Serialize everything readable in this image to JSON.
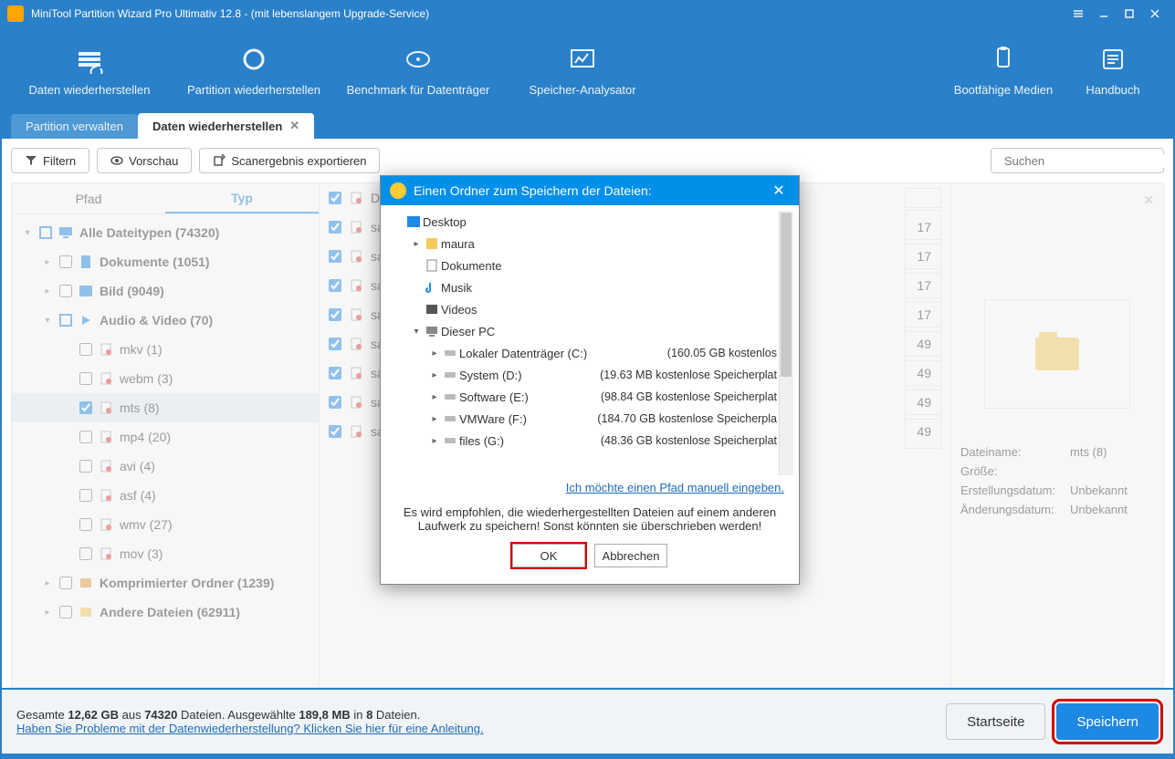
{
  "window": {
    "title": "MiniTool Partition Wizard Pro Ultimativ 12.8 - (mit lebenslangem Upgrade-Service)"
  },
  "ribbon": {
    "items": [
      {
        "label": "Daten wiederherstellen",
        "icon": "recover-data-icon"
      },
      {
        "label": "Partition wiederherstellen",
        "icon": "recover-partition-icon"
      },
      {
        "label": "Benchmark für Datenträger",
        "icon": "benchmark-icon"
      },
      {
        "label": "Speicher-Analysator",
        "icon": "analyzer-icon"
      }
    ],
    "right": [
      {
        "label": "Bootfähige Medien",
        "icon": "bootmedia-icon"
      },
      {
        "label": "Handbuch",
        "icon": "manual-icon"
      }
    ]
  },
  "tabs": {
    "inactive_label": "Partition verwalten",
    "active_label": "Daten wiederherstellen"
  },
  "toolbar": {
    "filter": "Filtern",
    "preview": "Vorschau",
    "export": "Scanergebnis exportieren",
    "search_placeholder": "Suchen"
  },
  "left_tabs": {
    "path": "Pfad",
    "type": "Typ"
  },
  "tree": [
    {
      "indent": 0,
      "chev": "▾",
      "chk": "blue",
      "icon": "monitor",
      "label": "Alle Dateitypen (74320)",
      "bold": true
    },
    {
      "indent": 1,
      "chev": "▸",
      "chk": "none",
      "icon": "doc",
      "label": "Dokumente (1051)",
      "bold": true
    },
    {
      "indent": 1,
      "chev": "▸",
      "chk": "none",
      "icon": "img",
      "label": "Bild (9049)",
      "bold": true
    },
    {
      "indent": 1,
      "chev": "▾",
      "chk": "blue",
      "icon": "av",
      "label": "Audio & Video (70)",
      "bold": true
    },
    {
      "indent": 2,
      "chev": "",
      "chk": "none",
      "icon": "file",
      "label": "mkv (1)"
    },
    {
      "indent": 2,
      "chev": "",
      "chk": "none",
      "icon": "file",
      "label": "webm (3)"
    },
    {
      "indent": 2,
      "chev": "",
      "chk": "checkblue",
      "icon": "file",
      "label": "mts (8)",
      "sel": true
    },
    {
      "indent": 2,
      "chev": "",
      "chk": "none",
      "icon": "file",
      "label": "mp4 (20)"
    },
    {
      "indent": 2,
      "chev": "",
      "chk": "none",
      "icon": "file",
      "label": "avi (4)"
    },
    {
      "indent": 2,
      "chev": "",
      "chk": "none",
      "icon": "file",
      "label": "asf (4)"
    },
    {
      "indent": 2,
      "chev": "",
      "chk": "none",
      "icon": "file",
      "label": "wmv (27)"
    },
    {
      "indent": 2,
      "chev": "",
      "chk": "none",
      "icon": "file",
      "label": "mov (3)"
    },
    {
      "indent": 1,
      "chev": "▸",
      "chk": "none",
      "icon": "zip",
      "label": "Komprimierter Ordner (1239)",
      "bold": true
    },
    {
      "indent": 1,
      "chev": "▸",
      "chk": "none",
      "icon": "other",
      "label": "Andere Dateien (62911)",
      "bold": true
    }
  ],
  "files": [
    {
      "name": "Date",
      "right": ""
    },
    {
      "name": "sam",
      "right": "17"
    },
    {
      "name": "sam",
      "right": "17"
    },
    {
      "name": "sam",
      "right": "17"
    },
    {
      "name": "sam",
      "right": "17"
    },
    {
      "name": "sam",
      "right": "49"
    },
    {
      "name": "sam",
      "right": "49"
    },
    {
      "name": "sam",
      "right": "49"
    },
    {
      "name": "sam",
      "right": "49"
    }
  ],
  "preview": {
    "filename_k": "Dateiname:",
    "filename_v": "mts (8)",
    "size_k": "Größe:",
    "size_v": "",
    "created_k": "Erstellungsdatum:",
    "created_v": "Unbekannt",
    "modified_k": "Änderungsdatum:",
    "modified_v": "Unbekannt"
  },
  "footer": {
    "line1_a": "Gesamte ",
    "line1_b": "12,62 GB",
    "line1_c": " aus ",
    "line1_d": "74320",
    "line1_e": " Dateien.   Ausgewählte ",
    "line1_f": "189,8 MB",
    "line1_g": " in ",
    "line1_h": "8",
    "line1_i": " Dateien.",
    "help_link": "Haben Sie Probleme mit der Datenwiederherstellung? Klicken Sie hier für eine Anleitung.",
    "home_btn": "Startseite",
    "save_btn": "Speichern"
  },
  "modal": {
    "title": "Einen Ordner zum Speichern der Dateien:",
    "rows": [
      {
        "indent": 0,
        "chev": "",
        "icon": "desktop",
        "name": "Desktop",
        "size": "",
        "sel": true
      },
      {
        "indent": 1,
        "chev": "▸",
        "icon": "user",
        "name": "maura",
        "size": ""
      },
      {
        "indent": 1,
        "chev": "",
        "icon": "doc",
        "name": "Dokumente",
        "size": ""
      },
      {
        "indent": 1,
        "chev": "",
        "icon": "music",
        "name": "Musik",
        "size": ""
      },
      {
        "indent": 1,
        "chev": "",
        "icon": "video",
        "name": "Videos",
        "size": ""
      },
      {
        "indent": 1,
        "chev": "▾",
        "icon": "pc",
        "name": "Dieser PC",
        "size": ""
      },
      {
        "indent": 2,
        "chev": "▸",
        "icon": "drive",
        "name": "Lokaler Datenträger (C:)",
        "size": "(160.05 GB kostenlos"
      },
      {
        "indent": 2,
        "chev": "▸",
        "icon": "drive",
        "name": "System (D:)",
        "size": "(19.63 MB kostenlose Speicherplat"
      },
      {
        "indent": 2,
        "chev": "▸",
        "icon": "drive",
        "name": "Software (E:)",
        "size": "(98.84 GB kostenlose Speicherplat"
      },
      {
        "indent": 2,
        "chev": "▸",
        "icon": "drive",
        "name": "VMWare (F:)",
        "size": "(184.70 GB kostenlose Speicherpla"
      },
      {
        "indent": 2,
        "chev": "▸",
        "icon": "drive",
        "name": "files (G:)",
        "size": "(48.36 GB kostenlose Speicherplat"
      }
    ],
    "manual_link": "Ich möchte einen Pfad manuell eingeben.",
    "warn1": "Es wird empfohlen, die wiederhergestellten Dateien auf einem anderen",
    "warn2": "Laufwerk zu speichern! Sonst könnten sie überschrieben werden!",
    "ok": "OK",
    "cancel": "Abbrechen"
  }
}
